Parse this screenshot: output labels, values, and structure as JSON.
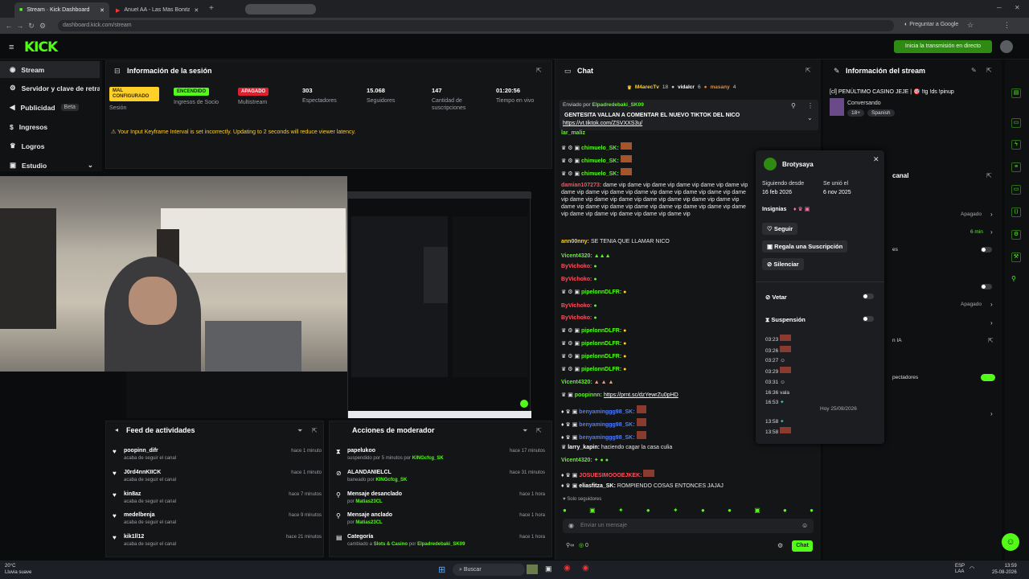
{
  "browser": {
    "tabs": [
      {
        "label": "Stream · Kick Dashboard"
      },
      {
        "label": "Anuel AA - Las Más Bonitas So..."
      }
    ],
    "url": "dashboard.kick.com/stream",
    "ask_google": "Preguntar a Google"
  },
  "header": {
    "logo": "KICK",
    "golive": "Inicia la transmisión en directo"
  },
  "sidebar": {
    "items": [
      {
        "label": "Stream"
      },
      {
        "label": "Servidor y clave de retran"
      },
      {
        "label": "Publicidad"
      },
      {
        "label": "Ingresos"
      },
      {
        "label": "Logros"
      },
      {
        "label": "Estudio"
      }
    ],
    "beta": "Beta"
  },
  "session": {
    "title": "Información de la sesión",
    "stats": [
      {
        "value": "MAL CONFIGURADO",
        "label": "Sesión"
      },
      {
        "value": "ENCENDIDO",
        "label": "Ingresos de Socio"
      },
      {
        "value": "APAGADO",
        "label": "Multistream"
      },
      {
        "value": "303",
        "label": "Espectadores"
      },
      {
        "value": "15.068",
        "label": "Seguidores"
      },
      {
        "value": "147",
        "label": "Cantidad de suscripciones"
      },
      {
        "value": "01:20:56",
        "label": "Tiempo en vivo"
      }
    ],
    "warning": "Your Input Keyframe Interval is set incorrectly. Updating to 2 seconds will reduce viewer latency."
  },
  "feed": {
    "title": "Feed de actividades",
    "rows": [
      {
        "name": "poopinn_difr",
        "sub": "acaba de seguir el canal",
        "time": "hace 1 minuto"
      },
      {
        "name": "J0rd4nnKIICK",
        "sub": "acaba de seguir el canal",
        "time": "hace 1 minuto"
      },
      {
        "name": "kin8az",
        "sub": "acaba de seguir el canal",
        "time": "hace 7 minutos"
      },
      {
        "name": "medelbenja",
        "sub": "acaba de seguir el canal",
        "time": "hace 9 minutos"
      },
      {
        "name": "kik1ll12",
        "sub": "acaba de seguir el canal",
        "time": "hace 21 minutos"
      }
    ]
  },
  "modactions": {
    "title": "Acciones de moderador",
    "rows": [
      {
        "name": "papelukoo",
        "sub": "suspendido por 5 minutos por",
        "by": "KINGcfcg_SK",
        "time": "hace 17 minutos"
      },
      {
        "name": "ALANDANIELCL",
        "sub": "baneado por",
        "by": "KINGcfcg_SK",
        "time": "hace 31 minutos"
      },
      {
        "name": "Mensaje desanclado",
        "sub": "por",
        "by": "Matias23CL",
        "time": "hace 1 hora"
      },
      {
        "name": "Mensaje anclado",
        "sub": "por",
        "by": "Matias23CL",
        "time": "hace 1 hora"
      },
      {
        "name": "Categoría",
        "sub": "cambiado a",
        "by": "Slots & Casino",
        "by2pre": "por",
        "by2": "Elpadredebaki_SK09",
        "time": "hace 1 hora"
      }
    ]
  },
  "chat": {
    "title": "Chat",
    "top_users": [
      "M4arecTv",
      "18",
      "vidalcr",
      "6",
      "masany",
      "4"
    ],
    "pinned_by_label": "Enviado por",
    "pinned_by": "Elpadredebaki_SK09",
    "pinned_text": "GENTESITA VALLAN A COMENTAR EL NUEVO TIKTOK DEL NICO",
    "pinned_link": "https://vt.tiktok.com/ZSVXXS3u/",
    "messages": [
      {
        "user": "lar_maliz",
        "text": ""
      },
      {
        "user": "chimuelo_SK:",
        "text": ""
      },
      {
        "user": "chimuelo_SK:",
        "text": ""
      },
      {
        "user": "chimuelo_SK:",
        "text": ""
      },
      {
        "user": "damian107273:",
        "text": "dame vip dame vip dame vip dame vip dame vip dame vip dame vip dame vip dame vip dame vip dame vip dame vip dame vip dame vip dame vip dame vip dame vip dame vip dame vip dame vip dame vip dame vip dame vip dame vip dame vip dame vip dame vip dame vip dame vip dame vip dame vip dame vip dame vip dame vip"
      },
      {
        "user": "ann00nny:",
        "text": "SE TENIA QUE LLAMAR NICO"
      },
      {
        "user": "Vicent4320:",
        "text": ""
      },
      {
        "user": "ByVichoko:",
        "text": ""
      },
      {
        "user": "ByVichoko:",
        "text": ""
      },
      {
        "user": "pipelonnDLFR:",
        "text": ""
      },
      {
        "user": "ByVichoko:",
        "text": ""
      },
      {
        "user": "ByVichoko:",
        "text": ""
      },
      {
        "user": "pipelonnDLFR:",
        "text": ""
      },
      {
        "user": "pipelonnDLFR:",
        "text": ""
      },
      {
        "user": "pipelonnDLFR:",
        "text": ""
      },
      {
        "user": "pipelonnDLFR:",
        "text": ""
      },
      {
        "user": "Vicent4320:",
        "text": ""
      },
      {
        "user": "poopinnn:",
        "text": "https://prnt.sc/dzYewrZu0pHD"
      },
      {
        "user": "benyaminggg98_SK:",
        "text": ""
      },
      {
        "user": "benyaminggg98_SK:",
        "text": ""
      },
      {
        "user": "benyaminggg98_SK:",
        "text": ""
      },
      {
        "user": "larry_kapin:",
        "text": "haciendo cagar la casa culia"
      },
      {
        "user": "Vicent4320:",
        "text": ""
      },
      {
        "user": "JOSUESIMOOOEJKEK:",
        "text": ""
      },
      {
        "user": "eliasfitza_SK:",
        "text": "ROMPIENDO COSAS ENTONCES JAJAJ"
      }
    ],
    "followers_only": "Solo seguidores",
    "placeholder": "Enviar un mensaje",
    "count": "0",
    "send": "Chat"
  },
  "popup": {
    "username": "Brotysaya",
    "following_label": "Siguiendo desde",
    "following_date": "16 feb 2026",
    "joined_label": "Se unió el",
    "joined_date": "6 nov 2025",
    "badges_label": "Insignias",
    "follow": "Seguir",
    "gift": "Regala una Suscripción",
    "mute": "Silenciar",
    "veto": "Vetar",
    "suspension": "Suspensión",
    "log_times": [
      "03:23",
      "03:26",
      "03:27",
      "03:29",
      "03:31",
      "16:36",
      "16:53"
    ],
    "log_text_vala": "vala",
    "date_sep": "Hoy 25/08/2026",
    "log_times2": [
      "13:58",
      "13:58"
    ]
  },
  "streaminfo": {
    "title": "Información del stream",
    "stream_title": "[cl] PENÚLTIMO CASINO JEJE | 🎯 !tg !ds !pinup",
    "category": "Conversando",
    "tags": [
      "18+",
      "Spanish"
    ],
    "channel": "canal",
    "items": [
      "Apagado",
      "6 min",
      "es",
      "Apagado",
      "n IA",
      "pectadores"
    ]
  },
  "taskbar": {
    "weather": "20°C",
    "weather_sub": "Lluvia suave",
    "search": "Buscar",
    "lang": "ESP",
    "lang2": "LAA",
    "time": "13:59",
    "date": "25-08-2026"
  },
  "colors": {
    "accent": "#53fc18",
    "bg": "#0b0c0d",
    "panel": "#141517",
    "warning": "#ffd028"
  }
}
